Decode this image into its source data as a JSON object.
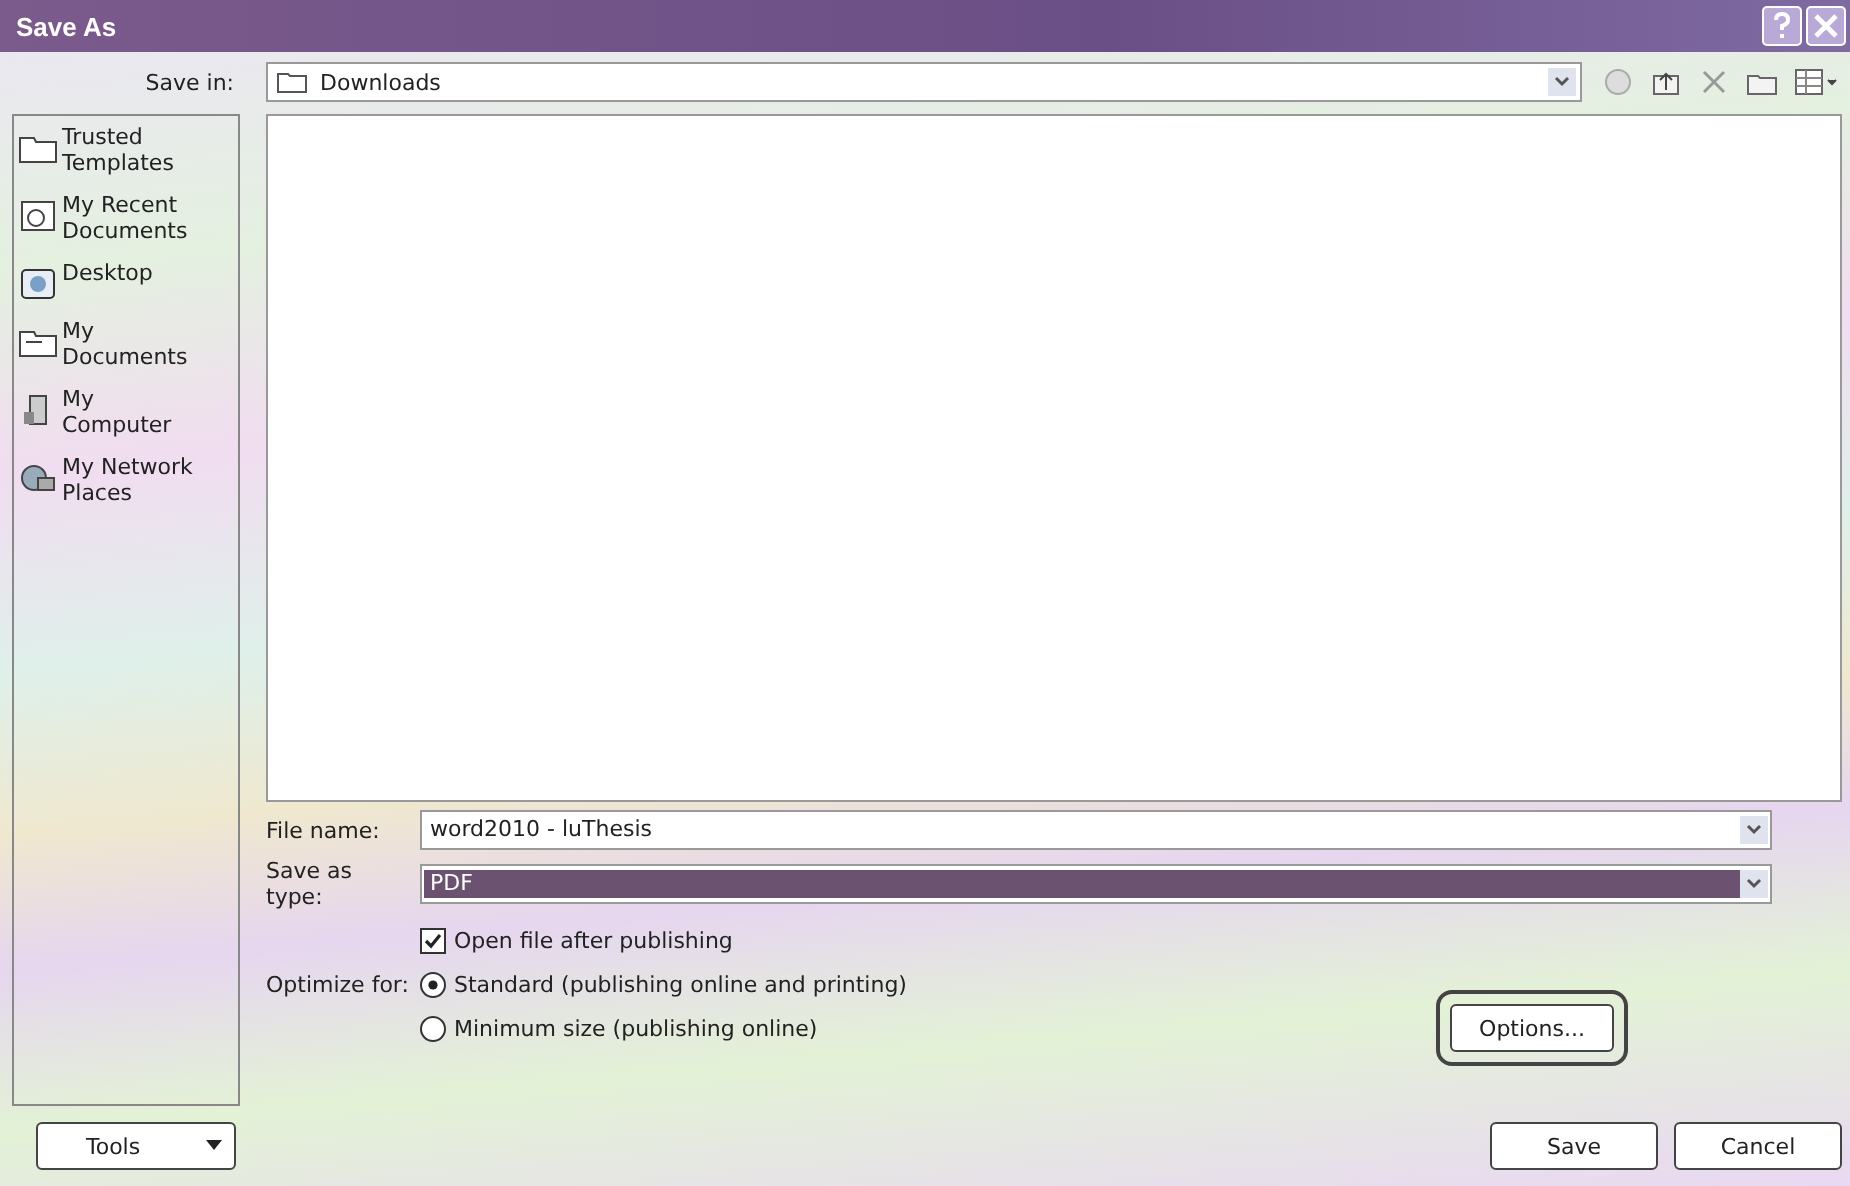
{
  "window": {
    "title": "Save As"
  },
  "save_in": {
    "label": "Save in:",
    "value": "Downloads"
  },
  "places": [
    {
      "label": "Trusted Templates",
      "kind": "templates"
    },
    {
      "label": "My Recent Documents",
      "kind": "recent"
    },
    {
      "label": "Desktop",
      "kind": "desktop"
    },
    {
      "label": "My Documents",
      "kind": "documents"
    },
    {
      "label": "My Computer",
      "kind": "computer"
    },
    {
      "label": "My Network Places",
      "kind": "network"
    }
  ],
  "file_name": {
    "label": "File name:",
    "value": "word2010 - luThesis"
  },
  "save_as_type": {
    "label": "Save as type:",
    "value": "PDF",
    "selected": true
  },
  "open_after": {
    "label": "Open file after publishing",
    "checked": true
  },
  "optimize": {
    "label": "Optimize for:",
    "options": [
      {
        "label": "Standard (publishing online and printing)",
        "selected": true
      },
      {
        "label": "Minimum size (publishing online)",
        "selected": false
      }
    ]
  },
  "options_button": "Options...",
  "tools_button": "Tools",
  "save_button": "Save",
  "cancel_button": "Cancel"
}
